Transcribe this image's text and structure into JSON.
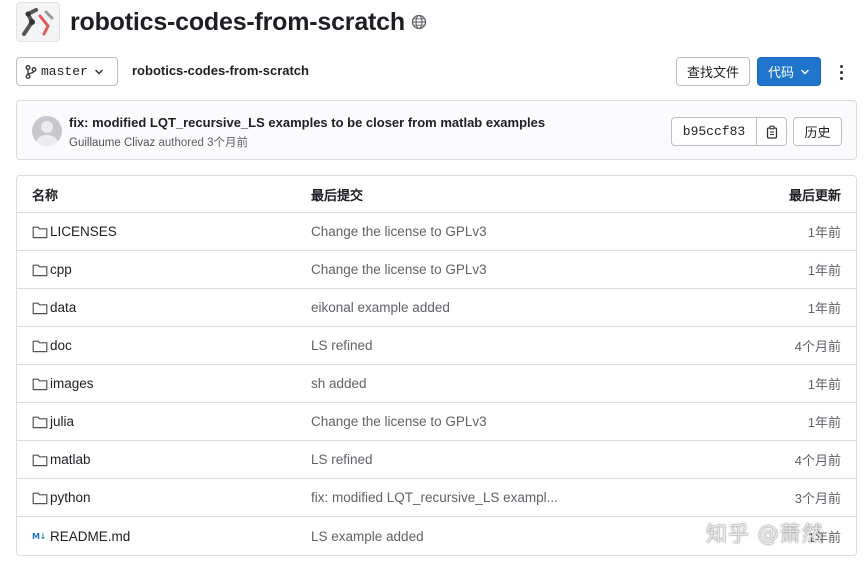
{
  "repo": {
    "title": "robotics-codes-from-scratch",
    "visibility_icon": "globe-icon"
  },
  "toolbar": {
    "branch": "master",
    "breadcrumb": "robotics-codes-from-scratch",
    "find_file_label": "查找文件",
    "code_label": "代码",
    "primary_color": "#1f75cb"
  },
  "commit": {
    "message": "fix: modified LQT_recursive_LS examples to be closer from matlab examples",
    "author": "Guillaume Clivaz",
    "authored_text": "authored",
    "time": "3个月前",
    "sha": "b95ccf83",
    "history_label": "历史"
  },
  "table": {
    "headers": {
      "name": "名称",
      "last_commit": "最后提交",
      "last_update": "最后更新"
    },
    "rows": [
      {
        "type": "folder",
        "name": "LICENSES",
        "commit": "Change the license to GPLv3",
        "date": "1年前"
      },
      {
        "type": "folder",
        "name": "cpp",
        "commit": "Change the license to GPLv3",
        "date": "1年前"
      },
      {
        "type": "folder",
        "name": "data",
        "commit": "eikonal example added",
        "date": "1年前"
      },
      {
        "type": "folder",
        "name": "doc",
        "commit": "LS refined",
        "date": "4个月前"
      },
      {
        "type": "folder",
        "name": "images",
        "commit": "sh added",
        "date": "1年前"
      },
      {
        "type": "folder",
        "name": "julia",
        "commit": "Change the license to GPLv3",
        "date": "1年前"
      },
      {
        "type": "folder",
        "name": "matlab",
        "commit": "LS refined",
        "date": "4个月前"
      },
      {
        "type": "folder",
        "name": "python",
        "commit": "fix: modified LQT_recursive_LS exampl...",
        "date": "3个月前"
      },
      {
        "type": "markdown",
        "name": "README.md",
        "commit": "LS example added",
        "date": "1年前"
      }
    ]
  },
  "watermark": "知乎 @萧然"
}
